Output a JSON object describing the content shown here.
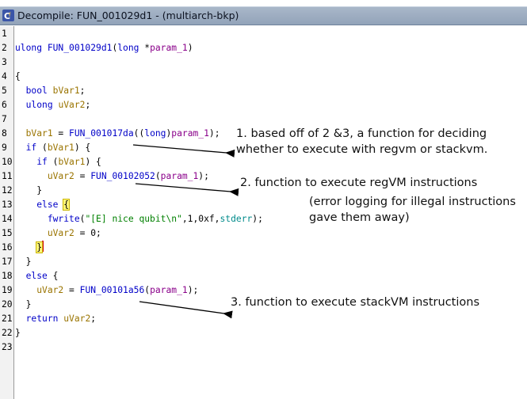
{
  "window": {
    "title": "Decompile: FUN_001029d1 - (multiarch-bkp)"
  },
  "line_numbers": [
    "1",
    "2",
    "3",
    "4",
    "5",
    "6",
    "7",
    "8",
    "9",
    "10",
    "11",
    "12",
    "13",
    "14",
    "15",
    "16",
    "17",
    "18",
    "19",
    "20",
    "21",
    "22",
    "23"
  ],
  "code": {
    "l2_ret": "ulong ",
    "l2_name": "FUN_001029d1",
    "l2_open": "(",
    "l2_type": "long",
    "l2_star": " *",
    "l2_param": "param_1",
    "l2_close": ")",
    "l4": "{",
    "l5_type": "bool",
    "l5_var": "bVar1",
    "l5_end": ";",
    "l6_type": "ulong",
    "l6_var": "uVar2",
    "l6_end": ";",
    "l8_var": "bVar1",
    "l8_eq": " = ",
    "l8_fn": "FUN_001017da",
    "l8_cast_open": "((",
    "l8_cast": "long",
    "l8_cast_close": ")",
    "l8_param": "param_1",
    "l8_end": ");",
    "l9_kw": "if",
    "l9_open": " (",
    "l9_var": "bVar1",
    "l9_end": ") {",
    "l10_kw": "if",
    "l10_open": " (",
    "l10_var": "bVar1",
    "l10_end": ") {",
    "l11_var": "uVar2",
    "l11_eq": " = ",
    "l11_fn": "FUN_00102052",
    "l11_open": "(",
    "l11_param": "param_1",
    "l11_end": ");",
    "l12": "}",
    "l13_kw": "else",
    "l13_brace": "{",
    "l14_fn": "fwrite",
    "l14_open": "(",
    "l14_str": "\"[E] nice qubit\\n\"",
    "l14_mid": ",1,0xf,",
    "l14_glb": "stderr",
    "l14_end": ");",
    "l15_var": "uVar2",
    "l15_end": " = 0;",
    "l16": "}",
    "l17": "}",
    "l18_kw": "else",
    "l18_end": " {",
    "l19_var": "uVar2",
    "l19_eq": " = ",
    "l19_fn": "FUN_00101a56",
    "l19_open": "(",
    "l19_param": "param_1",
    "l19_end": ");",
    "l20": "}",
    "l21_kw": "return",
    "l21_var": "uVar2",
    "l21_end": ";",
    "l22": "}"
  },
  "annotations": {
    "note1_line1": "1. based off of 2 &3, a function for deciding",
    "note1_line2": "whether to execute with regvm or stackvm.",
    "note2": "2. function to execute regVM instructions",
    "note2b_line1": "(error logging for illegal instructions",
    "note2b_line2": "gave them away)",
    "note3": "3. function to execute stackVM instructions"
  },
  "colors": {
    "keyword": "#0000c8",
    "variable": "#9a7400",
    "parameter": "#8a008a",
    "string": "#008000",
    "global": "#008b8b",
    "title_bar": "#a9b7c9",
    "cursor": "#d30000"
  }
}
